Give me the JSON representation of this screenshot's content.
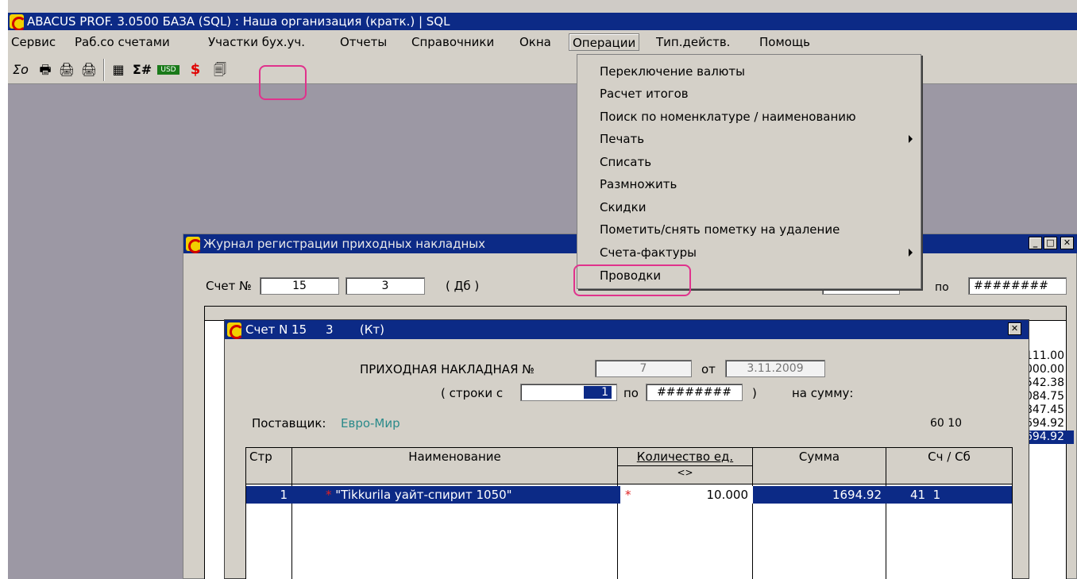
{
  "app": {
    "title": "ABACUS PROF. 3.0500   БАЗА (SQL) : Наша организация (кратк.)  |  SQL"
  },
  "menubar": {
    "items": [
      "Сервис",
      "Раб.со счетами",
      "Участки бух.уч.",
      "Отчеты",
      "Справочники",
      "Окна",
      "Операции",
      "Тип.действ.",
      "Помощь"
    ]
  },
  "toolbar": {
    "sigma_label": "Σo",
    "sigma_hash_label": "Σ#",
    "usd_label": "USD",
    "dollar_label": "$"
  },
  "dropdown": {
    "items": [
      "Переключение валюты",
      "Расчет итогов",
      "Поиск по номенклатуре / наименованию",
      "Печать",
      "Списать",
      "Размножить",
      "Скидки",
      "Пометить/снять пометку на удаление",
      "Счета-фактуры",
      "Проводки"
    ]
  },
  "journal": {
    "title": "Журнал регистрации приходных накладных",
    "account_label": "Счет №",
    "account_1": "15",
    "account_2": "3",
    "dt_label": "( Дб )",
    "to_label": "по",
    "to_value": "########",
    "side_values": [
      "111.00",
      "000.00",
      "542.38",
      "084.75",
      "847.45",
      "694.92",
      "694.92"
    ]
  },
  "invoice": {
    "title": "Счет N 15     3       (Кт)",
    "doc_label": "ПРИХОДНАЯ  НАКЛАДНАЯ №",
    "doc_number": "7",
    "from_label": "от",
    "doc_date": "3.11.2009",
    "rows_label": "( строки с",
    "rows_from": "1",
    "rows_to_label": "по",
    "rows_to": "########",
    "rows_close": ")",
    "sum_label": "на сумму:",
    "supplier_label": "Поставщик:",
    "supplier": "Евро-Мир",
    "account_code": "60 10",
    "grid": {
      "headers": [
        "Стр",
        "Наименование",
        "Количество ед.",
        "Сумма",
        "Сч / Сб"
      ],
      "qty_sub": "<>",
      "row": {
        "num": "1",
        "name": "\"Tikkurila уайт-спирит 1050\"",
        "qty": "10.000",
        "sum": "1694.92",
        "acc": "41  1"
      }
    }
  },
  "colors": {
    "title_bar": "#0c2a86",
    "face": "#d4d0c8",
    "desktop": "#9c98a4",
    "highlight": "#e0328c",
    "supplier_text": "#2a8a8a"
  }
}
